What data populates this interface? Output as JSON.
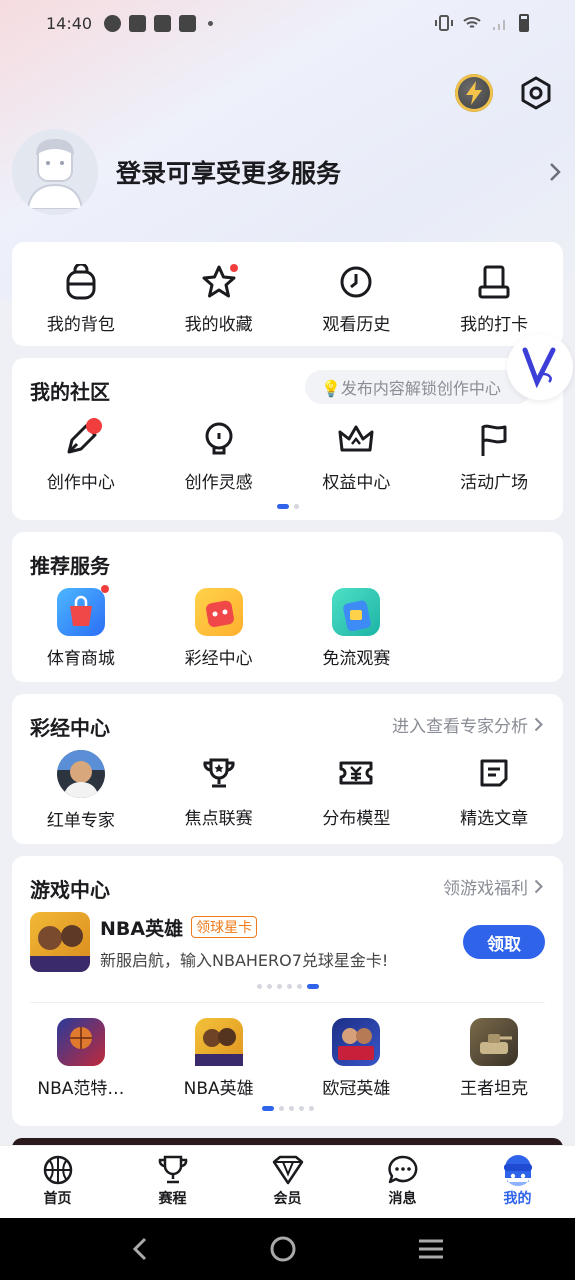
{
  "status_bar": {
    "time": "14:40"
  },
  "profile": {
    "login_prompt": "登录可享受更多服务"
  },
  "quick": {
    "items": [
      {
        "label": "我的背包",
        "icon": "backpack-icon"
      },
      {
        "label": "我的收藏",
        "icon": "star-icon"
      },
      {
        "label": "观看历史",
        "icon": "clock-icon"
      },
      {
        "label": "我的打卡",
        "icon": "stamp-icon"
      }
    ]
  },
  "community": {
    "title": "我的社区",
    "promo": "💡发布内容解锁创作中心",
    "items": [
      {
        "label": "创作中心",
        "icon": "pen-icon"
      },
      {
        "label": "创作灵感",
        "icon": "bulb-icon"
      },
      {
        "label": "权益中心",
        "icon": "crown-icon"
      },
      {
        "label": "活动广场",
        "icon": "flag-icon"
      }
    ]
  },
  "recommended": {
    "title": "推荐服务",
    "items": [
      {
        "label": "体育商城",
        "icon": "shopping-bag-icon"
      },
      {
        "label": "彩经中心",
        "icon": "lottery-icon"
      },
      {
        "label": "免流观赛",
        "icon": "sim-card-icon"
      }
    ]
  },
  "lottery": {
    "title": "彩经中心",
    "link": "进入查看专家分析",
    "items": [
      {
        "label": "红单专家",
        "icon": "expert-avatar"
      },
      {
        "label": "焦点联赛",
        "icon": "trophy-icon"
      },
      {
        "label": "分布模型",
        "icon": "ticket-icon"
      },
      {
        "label": "精选文章",
        "icon": "article-icon"
      }
    ]
  },
  "games": {
    "title": "游戏中心",
    "link": "领游戏福利",
    "featured": {
      "name": "NBA英雄",
      "tag": "领球星卡",
      "desc": "新服启航，输入NBAHERO7兑球星金卡!",
      "button": "领取"
    },
    "items": [
      {
        "label": "NBA范特…"
      },
      {
        "label": "NBA英雄"
      },
      {
        "label": "欧冠英雄"
      },
      {
        "label": "王者坦克"
      }
    ]
  },
  "tabs": [
    {
      "label": "首页",
      "icon": "basketball-icon"
    },
    {
      "label": "赛程",
      "icon": "trophy-icon"
    },
    {
      "label": "会员",
      "icon": "diamond-icon"
    },
    {
      "label": "消息",
      "icon": "chat-icon"
    },
    {
      "label": "我的",
      "icon": "profile-icon"
    }
  ],
  "colors": {
    "accent": "#2f63ea",
    "badge": "#f23d3d",
    "tag": "#f07a1a"
  }
}
